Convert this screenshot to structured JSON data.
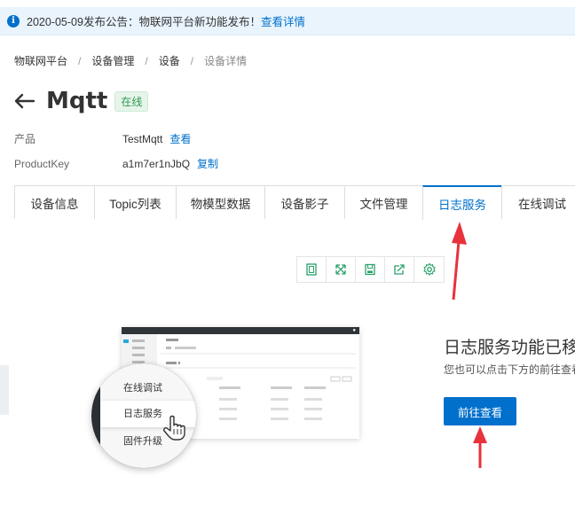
{
  "notice": {
    "text": "2020-05-09发布公告：物联网平台新功能发布！",
    "link": "查看详情"
  },
  "breadcrumb": [
    "物联网平台",
    "设备管理",
    "设备",
    "设备详情"
  ],
  "device": {
    "name": "Mqtt",
    "status": "在线"
  },
  "meta": {
    "product_label": "产品",
    "product_value": "TestMqtt",
    "product_link": "查看",
    "key_label": "ProductKey",
    "key_value": "a1m7er1nJbQ",
    "key_link": "复制"
  },
  "tabs": [
    "设备信息",
    "Topic列表",
    "物模型数据",
    "设备影子",
    "文件管理",
    "日志服务",
    "在线调试"
  ],
  "active_tab": "日志服务",
  "toolbar_icons": [
    "fullscreen-icon",
    "expand-icon",
    "save-icon",
    "share-icon",
    "settings-icon"
  ],
  "illustration": {
    "items": [
      "在线调试",
      "日志服务",
      "固件升级"
    ]
  },
  "migrate": {
    "title": "日志服务功能已移至",
    "desc": "您也可以点击下方的前往查看",
    "button": "前往查看"
  },
  "colors": {
    "accent": "#0070cc",
    "online": "#2d9b4c",
    "annotation": "#e8323c"
  }
}
